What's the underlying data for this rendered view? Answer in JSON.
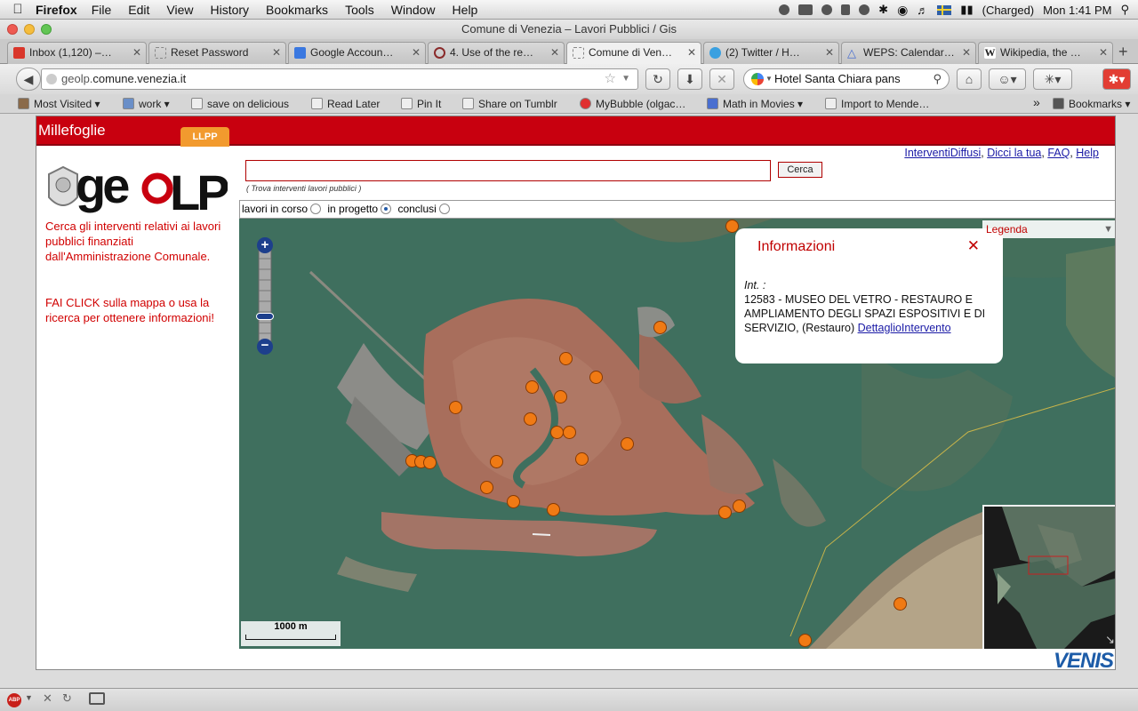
{
  "menubar": {
    "app": "Firefox",
    "items": [
      "File",
      "Edit",
      "View",
      "History",
      "Bookmarks",
      "Tools",
      "Window",
      "Help"
    ],
    "battery": "(Charged)",
    "clock": "Mon 1:41 PM"
  },
  "window": {
    "title": "Comune di Venezia – Lavori Pubblici / Gis"
  },
  "tabs": [
    {
      "label": "Inbox (1,120) –…",
      "color": "#d9362b"
    },
    {
      "label": "Reset Password",
      "color": "#bbbbbb"
    },
    {
      "label": "Google Accoun…",
      "color": "#3a78e0"
    },
    {
      "label": "4. Use of the re…",
      "color": "#8a2a2a"
    },
    {
      "label": "Comune di Ven…",
      "color": "#bbbbbb"
    },
    {
      "label": "(2) Twitter / H…",
      "color": "#3aa0e0"
    },
    {
      "label": "WEPS: Calendar…",
      "color": "#4a6fd0"
    },
    {
      "label": "Wikipedia, the …",
      "color": "#ffffff"
    }
  ],
  "nav": {
    "url_prefix": "geolp.",
    "url_domain": "comune.venezia.it",
    "search_value": "Hotel Santa Chiara pans"
  },
  "bookmarks": {
    "items": [
      "Most Visited ▾",
      "work ▾",
      "save on delicious",
      "Read Later",
      "Pin It",
      "Share on Tumblr",
      "MyBubble (olgac…",
      "Math in Movies ▾",
      "Import to Mende…"
    ],
    "overflow": "»",
    "menu": "Bookmarks ▾"
  },
  "site": {
    "brand": "Millefoglie",
    "tab": "LLPP",
    "logo_text": "geoLP",
    "intro_1": "Cerca gli interventi relativi ai lavori pubblici finanziati dall'Amministrazione Comunale.",
    "intro_2": "FAI CLICK sulla mappa o usa la ricerca per ottenere informazioni!",
    "links": [
      "InterventiDiffusi",
      "Dicci la tua",
      "FAQ",
      "Help"
    ],
    "search_placeholder": "",
    "search_button": "Cerca",
    "search_hint": "( Trova interventi lavori pubblici )",
    "filters": [
      {
        "label": "lavori in corso",
        "checked": false
      },
      {
        "label": "in progetto",
        "checked": true
      },
      {
        "label": "conclusi",
        "checked": false
      }
    ],
    "footer_logo": "VENIS"
  },
  "map": {
    "legend": "Legenda",
    "scale": "1000 m",
    "popup": {
      "title": "Informazioni",
      "close": "✕",
      "int_label": "Int. :",
      "description": "12583 - MUSEO DEL VETRO - RESTAURO E AMPLIAMENTO DEGLI SPAZI ESPOSITIVI E DI SERVIZIO, (Restauro)",
      "link": "DettaglioIntervento"
    },
    "marker_color": "#f07a14"
  }
}
